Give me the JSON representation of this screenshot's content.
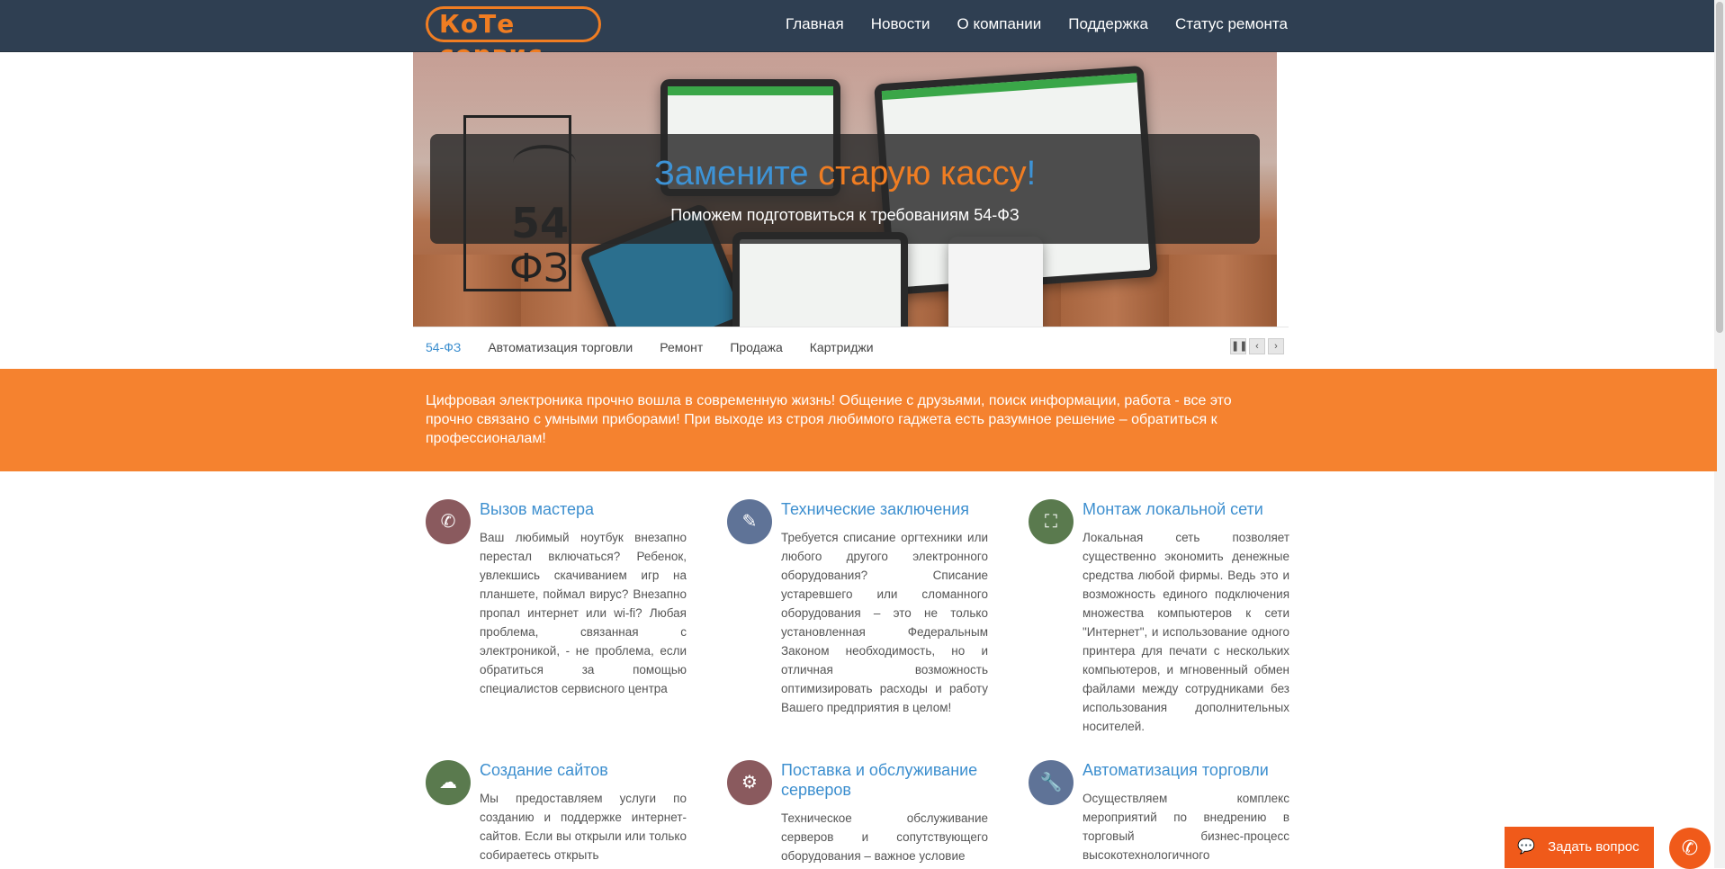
{
  "header": {
    "logo": "КоТе сервис",
    "nav": [
      "Главная",
      "Новости",
      "О компании",
      "Поддержка",
      "Статус ремонта"
    ]
  },
  "slider": {
    "title_part1": "Замените",
    "title_part2": "старую кассу",
    "title_part3": "!",
    "subtitle": "Поможем подготовиться к требованиям 54-ФЗ",
    "emblem_num": "54",
    "emblem_sub": "ФЗ",
    "tabs": [
      "54-ФЗ",
      "Автоматизация торговли",
      "Ремонт",
      "Продажа",
      "Картриджи"
    ]
  },
  "promo": {
    "text": "Цифровая электроника прочно вошла в современную жизнь! Общение с друзьями, поиск информации, работа - все это прочно связано с умными приборами! При выходе из строя любимого гаджета есть разумное решение – обратиться к профессионалам!"
  },
  "features": [
    {
      "title": "Вызов мастера",
      "text": "Ваш любимый ноутбук внезапно перестал включаться? Ребенок, увлекшись скачиванием игр на планшете, поймал вирус? Внезапно пропал интернет или wi-fi? Любая проблема, связанная с электроникой, - не проблема, если обратиться за помощью специалистов сервисного центра",
      "icon": "phone-icon",
      "color": "#8a5a5e"
    },
    {
      "title": "Технические заключения",
      "text": "Требуется списание оргтехники или любого другого электронного оборудования? Списание устаревшего или сломанного оборудования – это не только установленная Федеральным Законом необходимость, но и отличная возможность оптимизировать расходы и работу Вашего предприятия в целом!",
      "icon": "edit-icon",
      "color": "#5f7397"
    },
    {
      "title": "Монтаж локальной сети",
      "text": "Локальная сеть позволяет существенно экономить денежные средства любой фирмы. Ведь это и возможность единого подключения множества компьютеров к сети \"Интернет\", и использование одного принтера для печати с нескольких компьютеров, и мгновенный обмен файлами между сотрудниками без использования дополнительных носителей.",
      "icon": "network-icon",
      "color": "#5a7a4e"
    },
    {
      "title": "Создание сайтов",
      "text": "Мы предоставляем услуги по созданию и поддержке интернет-сайтов. Если вы открыли или только собираетесь открыть",
      "icon": "cloud-icon",
      "color": "#5a7a4e"
    },
    {
      "title": "Поставка и обслуживание серверов",
      "text": "Техническое обслуживание серверов и сопутствующего оборудования – важное условие",
      "icon": "gears-icon",
      "color": "#8a5a5e"
    },
    {
      "title": "Автоматизация торговли",
      "text": "Осуществляем комплекс мероприятий по внедрению в торговый бизнес-процесс высокотехнологичного",
      "icon": "wrench-icon",
      "color": "#5f7397"
    }
  ],
  "widgets": {
    "ask_label": "Задать вопрос"
  }
}
